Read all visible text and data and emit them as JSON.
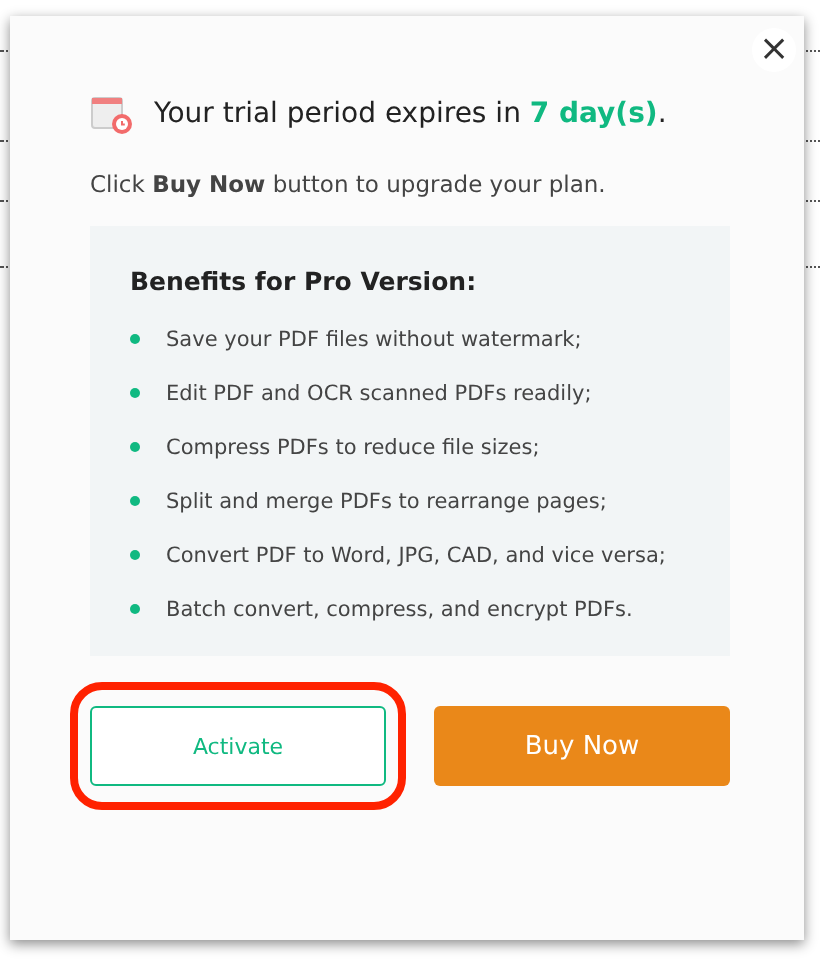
{
  "dialog": {
    "close": "×",
    "trial_message": "Your trial period expires in **7 day(s)**.",
    "hint": "Click **Buy Now** button to upgrade your plan.",
    "benefits": {
      "title": "Benefits for Pro Version:",
      "items": [
        "Save your PDF files without watermark;",
        "Edit PDF and OCR scanned PDFs readily;",
        "Compress PDFs to reduce file sizes;",
        "Split and merge PDFs to rearrange pages;",
        "Convert PDF to Word, JPG, CAD, and vice versa;",
        "Batch convert, compress, and encrypt PDFs."
      ]
    },
    "buttons": [
      {
        "label": "Activate",
        "kind": "outline",
        "highlighted": true
      },
      {
        "label": "Buy Now",
        "kind": "primary",
        "highlighted": false
      }
    ]
  }
}
